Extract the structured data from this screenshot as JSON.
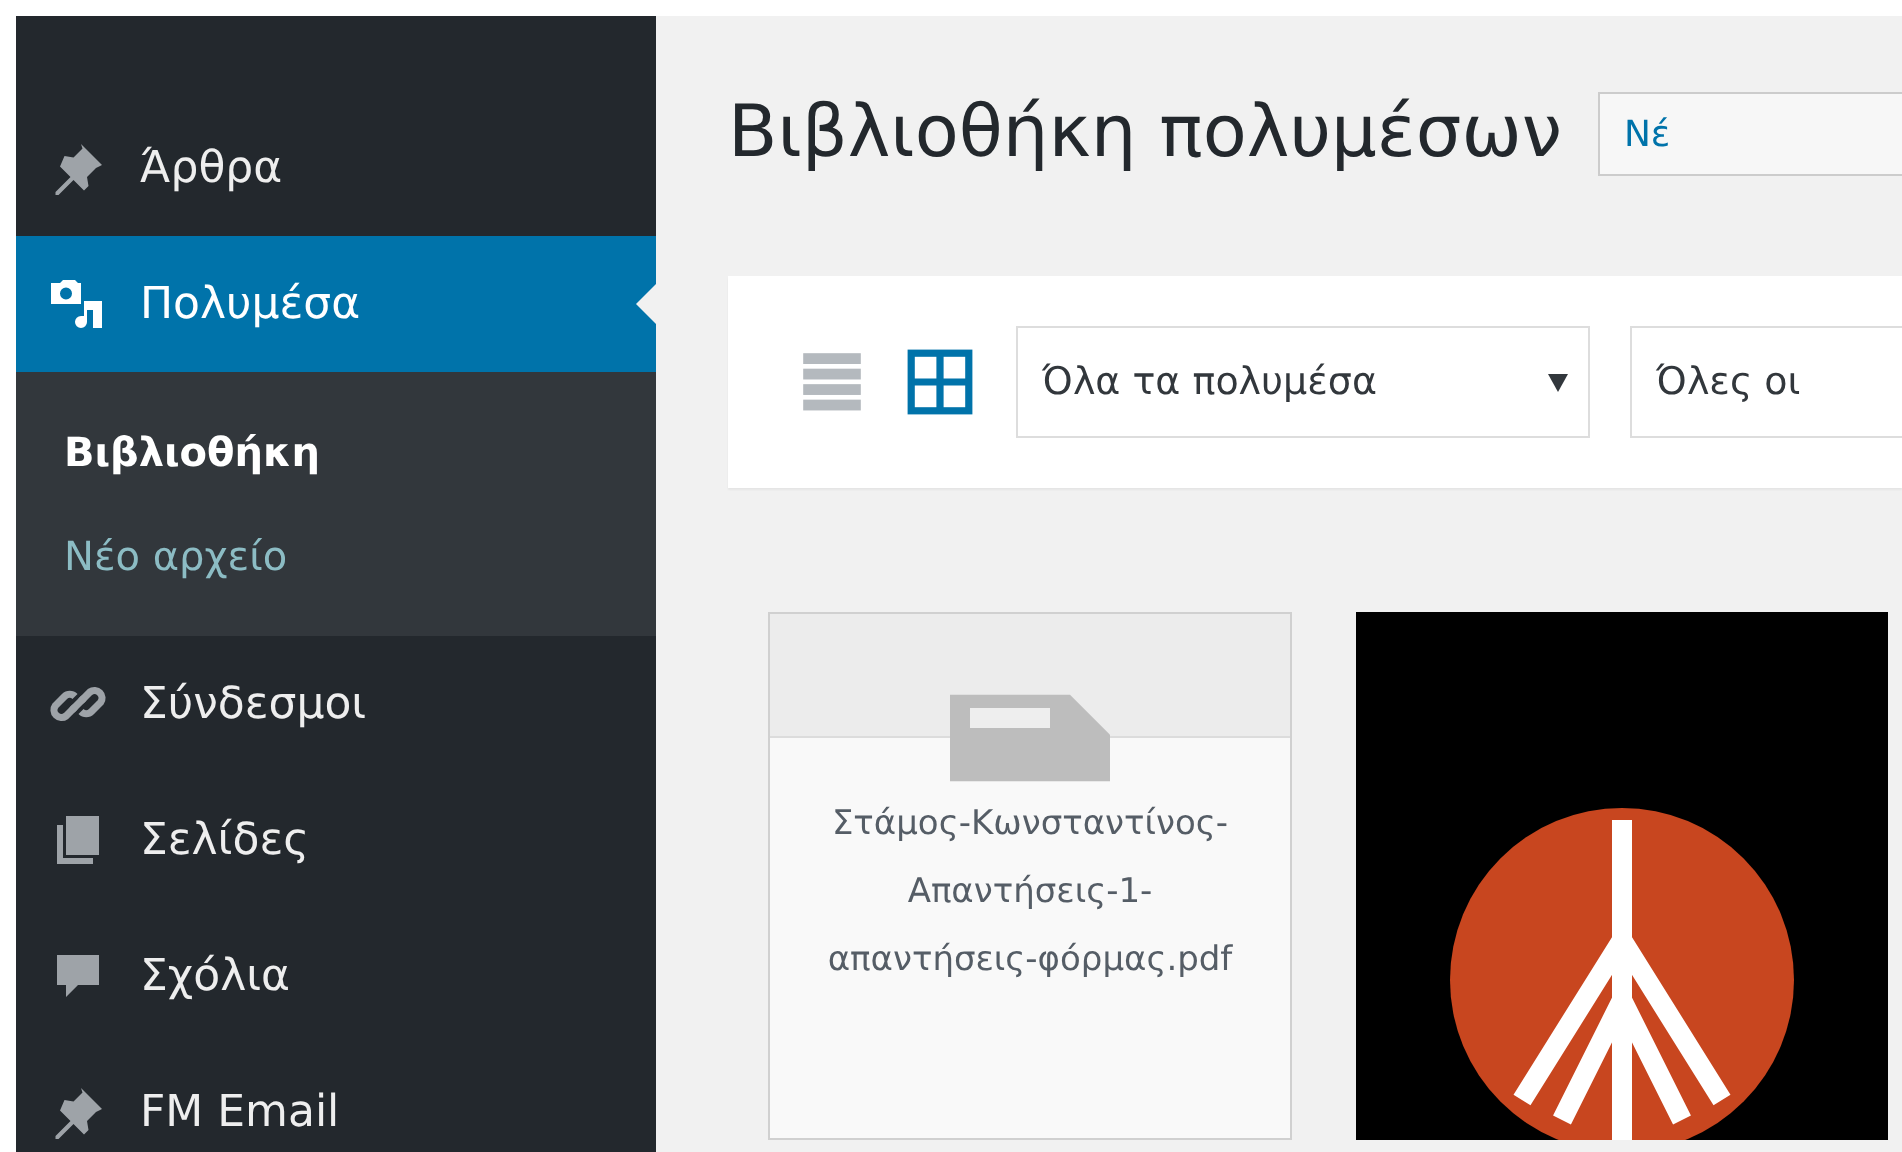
{
  "sidebar": {
    "items": [
      {
        "label": "Άρθρα",
        "selected": false
      },
      {
        "label": "Πολυμέσα",
        "selected": true,
        "children": [
          {
            "label": "Βιβλιοθήκη",
            "selected": true
          },
          {
            "label": "Νέο αρχείο",
            "selected": false
          }
        ]
      },
      {
        "label": "Σύνδεσμοι",
        "selected": false
      },
      {
        "label": "Σελίδες",
        "selected": false
      },
      {
        "label": "Σχόλια",
        "selected": false
      },
      {
        "label": "FM Email",
        "selected": false
      }
    ]
  },
  "page": {
    "title": "Βιβλιοθήκη πολυμέσων",
    "add_button": "Νέ"
  },
  "toolbar": {
    "views": [
      {
        "kind": "list",
        "selected": false
      },
      {
        "kind": "grid",
        "selected": true
      }
    ],
    "filters": [
      {
        "value": "Όλα τα πολυμέσα"
      },
      {
        "value": "Όλες οι"
      }
    ]
  },
  "attachments": [
    {
      "kind": "file",
      "filename": "Στάμος-Κωνσταντίνος-Απαντήσεις-1-απαντήσεις-φόρμας.pdf"
    },
    {
      "kind": "image"
    }
  ]
}
